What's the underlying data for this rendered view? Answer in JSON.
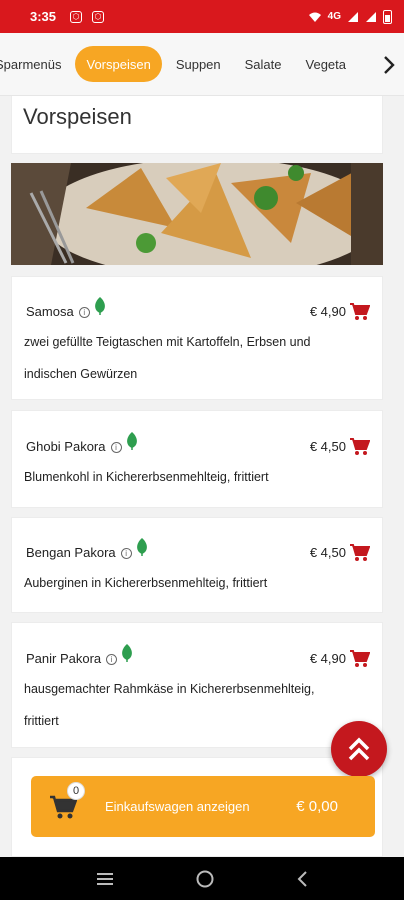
{
  "status_bar": {
    "time": "3:35",
    "network": "4G"
  },
  "tabs": [
    {
      "label": "Sparmenüs",
      "active": false
    },
    {
      "label": "Vorspeisen",
      "active": true
    },
    {
      "label": "Suppen",
      "active": false
    },
    {
      "label": "Salate",
      "active": false
    },
    {
      "label": "Vegeta",
      "active": false
    }
  ],
  "section": {
    "title": "Vorspeisen"
  },
  "items": [
    {
      "name": "Samosa",
      "price": "€ 4,90",
      "description_lines": [
        "zwei gefüllte Teigtaschen mit Kartoffeln, Erbsen und",
        "indischen Gewürzen"
      ]
    },
    {
      "name": "Ghobi Pakora",
      "price": "€ 4,50",
      "description_lines": [
        "Blumenkohl in Kichererbsenmehlteig, frittiert"
      ]
    },
    {
      "name": "Bengan Pakora",
      "price": "€ 4,50",
      "description_lines": [
        "Auberginen in Kichererbsenmehlteig, frittiert"
      ]
    },
    {
      "name": "Panir Pakora",
      "price": "€ 4,90",
      "description_lines": [
        "hausgemachter Rahmkäse in Kichererbsenmehlteig,",
        "frittiert"
      ]
    }
  ],
  "cart": {
    "count": "0",
    "label": "Einkaufswagen anzeigen",
    "total": "€ 0,00"
  },
  "colors": {
    "brand_red": "#d9181d",
    "accent_orange": "#f7a623",
    "veg_green": "#2e9e4f"
  },
  "icons": {
    "info": "info-icon",
    "veg": "leaf-icon",
    "add_to_cart": "cart-add-icon",
    "scroll_top": "double-chevron-up-icon"
  }
}
